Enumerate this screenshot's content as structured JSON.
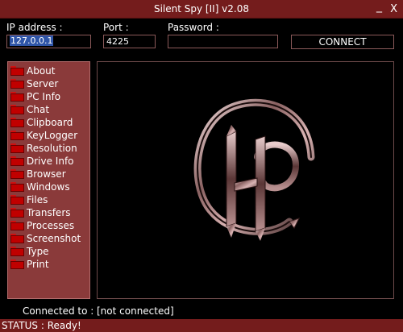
{
  "window": {
    "title": "Silent Spy [II] v2.08",
    "minimize_glyph": "_",
    "close_glyph": "X"
  },
  "connection": {
    "ip_label": "IP address :",
    "ip_value": "127.0.0.1",
    "port_label": "Port :",
    "port_value": "4225",
    "password_label": "Password :",
    "password_value": "",
    "connect_label": "CONNECT"
  },
  "sidebar": {
    "icon": "folder-icon",
    "items": [
      {
        "label": "About"
      },
      {
        "label": "Server"
      },
      {
        "label": "PC Info"
      },
      {
        "label": "Chat"
      },
      {
        "label": "Clipboard"
      },
      {
        "label": "KeyLogger"
      },
      {
        "label": "Resolution"
      },
      {
        "label": "Drive Info"
      },
      {
        "label": "Browser"
      },
      {
        "label": "Windows"
      },
      {
        "label": "Files"
      },
      {
        "label": "Transfers"
      },
      {
        "label": "Processes"
      },
      {
        "label": "Screenshot"
      },
      {
        "label": "Type"
      },
      {
        "label": "Print"
      }
    ]
  },
  "main": {
    "logo": "silent-spy-logo"
  },
  "footer": {
    "connected_label": "Connected to :",
    "connected_value": "[not connected]"
  },
  "status": {
    "text": "STATUS : Ready!"
  },
  "colors": {
    "titlebar": "#741c1c",
    "sidebar": "#8a3a3a",
    "border": "#8b5a5a",
    "selection": "#2f55a8",
    "folder": "#c00000"
  }
}
